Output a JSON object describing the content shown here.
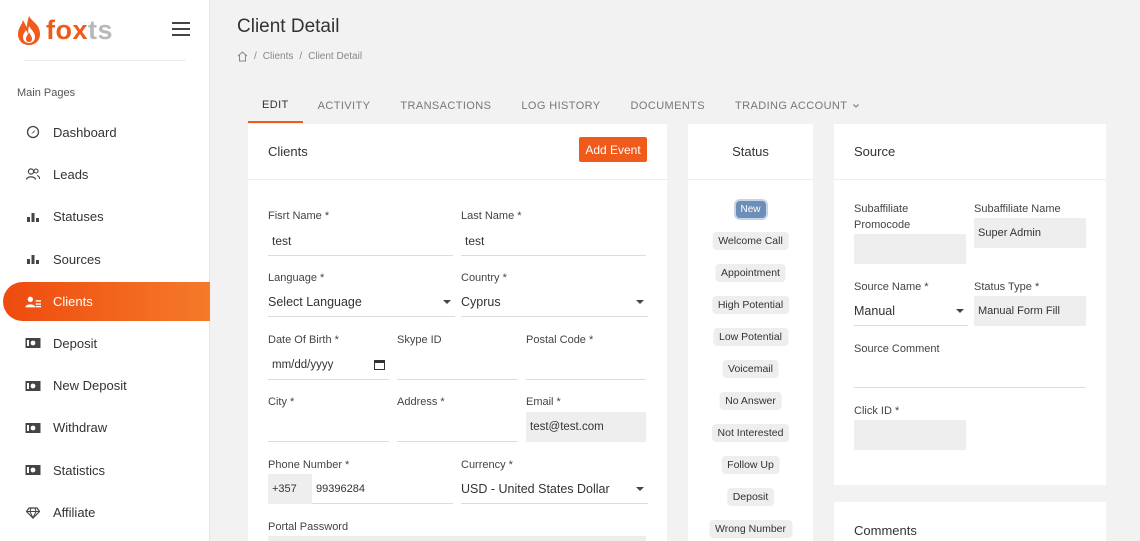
{
  "brand": {
    "name_main": "fox",
    "name_suffix": "ts"
  },
  "sidebar": {
    "section_label": "Main Pages",
    "items": [
      {
        "label": "Dashboard",
        "icon": "dashboard-icon"
      },
      {
        "label": "Leads",
        "icon": "users-icon"
      },
      {
        "label": "Statuses",
        "icon": "bar-chart-icon"
      },
      {
        "label": "Sources",
        "icon": "bar-chart-icon"
      },
      {
        "label": "Clients",
        "icon": "clients-icon",
        "active": true
      },
      {
        "label": "Deposit",
        "icon": "money-icon"
      },
      {
        "label": "New Deposit",
        "icon": "money-icon"
      },
      {
        "label": "Withdraw",
        "icon": "money-icon"
      },
      {
        "label": "Statistics",
        "icon": "money-icon"
      },
      {
        "label": "Affiliate",
        "icon": "diamond-icon"
      }
    ]
  },
  "header": {
    "title": "Client Detail",
    "breadcrumb": [
      "Clients",
      "Client Detail"
    ]
  },
  "tabs": [
    "EDIT",
    "ACTIVITY",
    "TRANSACTIONS",
    "LOG HISTORY",
    "DOCUMENTS",
    "TRADING ACCOUNT"
  ],
  "clients": {
    "title": "Clients",
    "add_event_label": "Add Event",
    "first_name_label": "Fisrt Name *",
    "first_name_value": "test",
    "last_name_label": "Last Name *",
    "last_name_value": "test",
    "language_label": "Language *",
    "language_value": "Select Language",
    "country_label": "Country *",
    "country_value": "Cyprus",
    "dob_label": "Date Of Birth *",
    "dob_placeholder": "mm/dd/yyyy",
    "skype_label": "Skype ID",
    "postal_label": "Postal Code *",
    "city_label": "City *",
    "address_label": "Address *",
    "email_label": "Email *",
    "email_value": "test@test.com",
    "phone_label": "Phone Number *",
    "phone_prefix": "+357",
    "phone_value": "99396284",
    "currency_label": "Currency *",
    "currency_value": "USD - United States Dollar",
    "portal_password_label": "Portal Password"
  },
  "status": {
    "title": "Status",
    "items": [
      "New",
      "Welcome Call",
      "Appointment",
      "High Potential",
      "Low Potential",
      "Voicemail",
      "No Answer",
      "Not Interested",
      "Follow Up",
      "Deposit",
      "Wrong Number"
    ]
  },
  "source": {
    "title": "Source",
    "subaffiliate_promocode_label": "Subaffiliate Promocode",
    "subaffiliate_name_label": "Subaffiliate Name",
    "subaffiliate_name_value": "Super Admin",
    "source_name_label": "Source Name *",
    "source_name_value": "Manual",
    "status_type_label": "Status Type *",
    "status_type_value": "Manual Form Fill",
    "source_comment_label": "Source Comment",
    "click_id_label": "Click ID *"
  },
  "comments": {
    "title": "Comments"
  },
  "colors": {
    "accent": "#f05a1a",
    "new_status": "#6b8fb8"
  }
}
